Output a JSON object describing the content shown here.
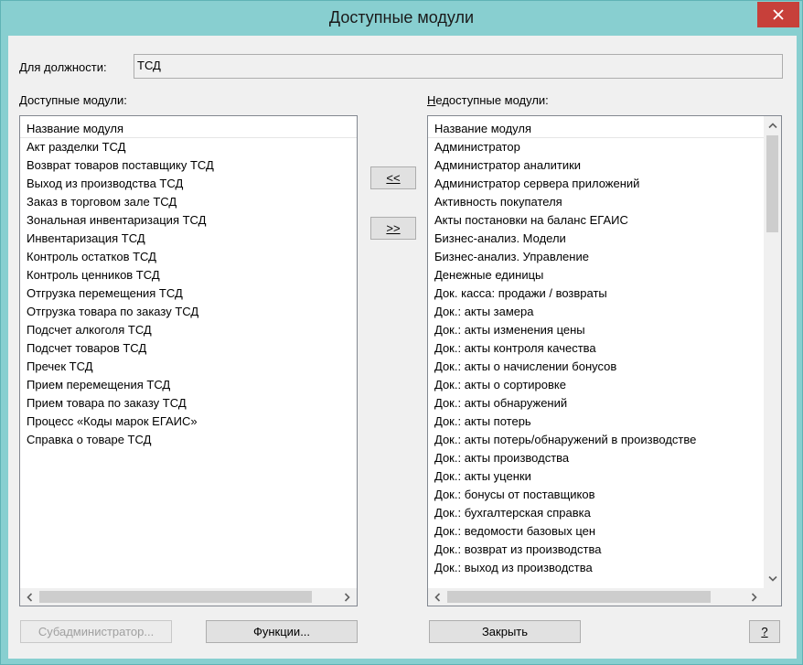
{
  "window": {
    "title": "Доступные модули"
  },
  "position_label": "Для должности:",
  "position_value": "ТСД",
  "available": {
    "label": "Доступные модули:",
    "column": "Название модуля",
    "items": [
      "Акт разделки ТСД",
      "Возврат товаров поставщику ТСД",
      "Выход из производства ТСД",
      "Заказ в торговом зале ТСД",
      "Зональная инвентаризация ТСД",
      "Инвентаризация ТСД",
      "Контроль остатков ТСД",
      "Контроль ценников ТСД",
      "Отгрузка перемещения ТСД",
      "Отгрузка товара по заказу ТСД",
      "Подсчет алкоголя ТСД",
      "Подсчет товаров ТСД",
      "Пречек ТСД",
      "Прием перемещения ТСД",
      "Прием товара по заказу ТСД",
      "Процесс «Коды марок ЕГАИС»",
      "Справка о товаре ТСД"
    ]
  },
  "unavailable": {
    "label": "Недоступные модули:",
    "column": "Название модуля",
    "items": [
      "Администратор",
      "Администратор аналитики",
      "Администратор сервера приложений",
      "Активность покупателя",
      "Акты постановки на баланс ЕГАИС",
      "Бизнес-анализ. Модели",
      "Бизнес-анализ. Управление",
      "Денежные единицы",
      "Док. касса: продажи / возвраты",
      "Док.: акты замера",
      "Док.: акты изменения цены",
      "Док.: акты контроля качества",
      "Док.: акты о начислении бонусов",
      "Док.: акты о сортировке",
      "Док.: акты обнаружений",
      "Док.: акты потерь",
      "Док.: акты потерь/обнаружений в производстве",
      "Док.: акты производства",
      "Док.: акты уценки",
      "Док.: бонусы от поставщиков",
      "Док.: бухгалтерская справка",
      "Док.: ведомости базовых цен",
      "Док.: возврат из производства",
      "Док.: выход из производства"
    ]
  },
  "move_left_label": "<<",
  "move_right_label": ">>",
  "buttons": {
    "subadmin": "Субадминистратор...",
    "functions": "Функции...",
    "close": "Закрыть",
    "help": "?"
  },
  "colors": {
    "frame": "#88cfd0",
    "close": "#c7403a",
    "dialog": "#f0f0f0"
  },
  "icons": {
    "close": "close-icon",
    "scroll_left": "chevron-left-icon",
    "scroll_right": "chevron-right-icon",
    "scroll_up": "chevron-up-icon",
    "scroll_down": "chevron-down-icon"
  }
}
